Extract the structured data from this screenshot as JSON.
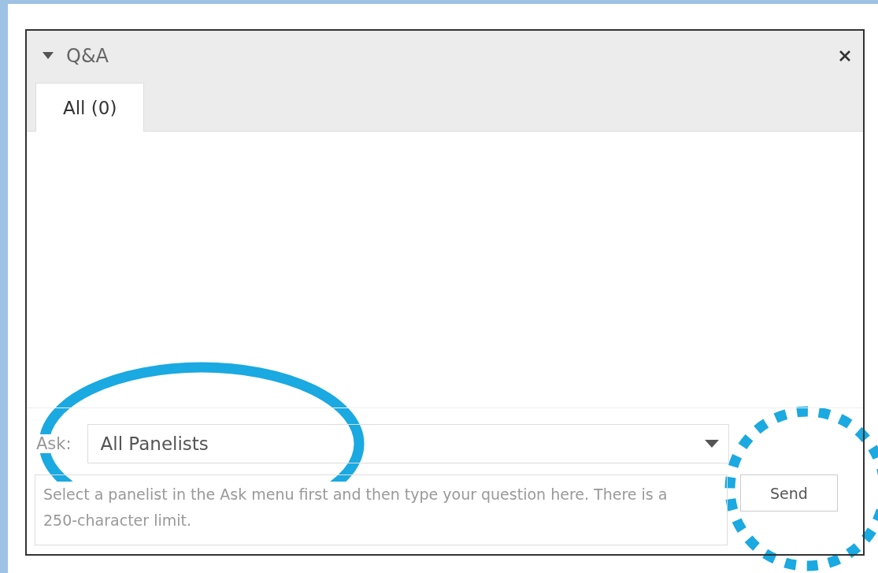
{
  "panel": {
    "title": "Q&A",
    "expanded": true
  },
  "tabs": [
    {
      "label": "All (0)",
      "selected": true
    }
  ],
  "ask": {
    "label": "Ask:",
    "value": "All Panelists"
  },
  "question": {
    "placeholder": "Select a panelist in the Ask menu first and then type your question here. There is a 250-character limit."
  },
  "send_button": "Send"
}
